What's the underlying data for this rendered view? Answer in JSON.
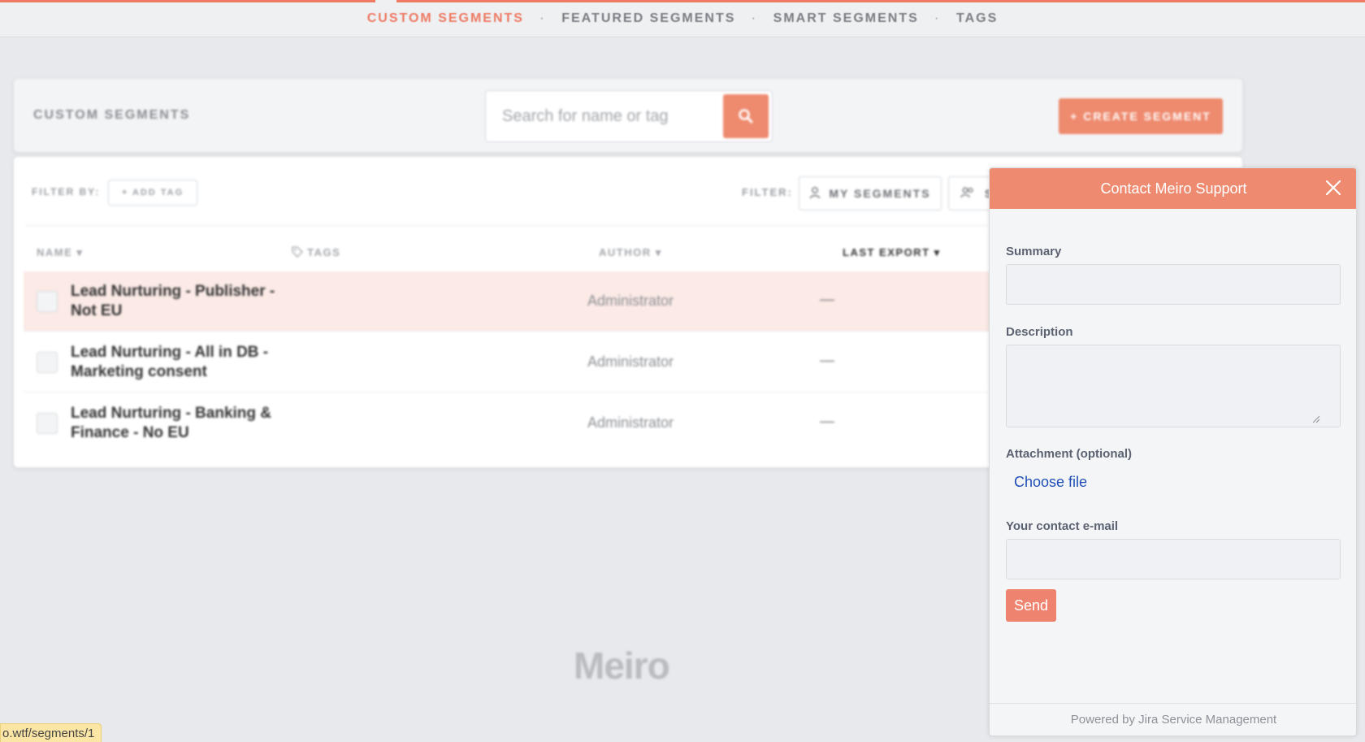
{
  "nav": {
    "items": [
      {
        "label": "CUSTOM SEGMENTS"
      },
      {
        "label": "FEATURED SEGMENTS"
      },
      {
        "label": "SMART SEGMENTS"
      },
      {
        "label": "TAGS"
      }
    ],
    "separator": "·"
  },
  "header": {
    "title": "CUSTOM SEGMENTS",
    "search_placeholder": "Search for name or tag",
    "search_icon": "search-icon",
    "create_label": "+ CREATE SEGMENT"
  },
  "filters": {
    "filter_by_label": "FILTER BY:",
    "add_tag_label": "+ ADD TAG",
    "filter_label": "FILTER:",
    "my_segments_label": "MY SEGMENTS",
    "shared_label": "S"
  },
  "table": {
    "columns": {
      "name": "NAME",
      "tags": "TAGS",
      "author": "AUTHOR",
      "last_export": "LAST EXPORT"
    },
    "rows": [
      {
        "name": "Lead Nurturing - Publisher - Not EU",
        "author": "Administrator",
        "last_export": "—"
      },
      {
        "name": "Lead Nurturing - All in DB - Marketing consent",
        "author": "Administrator",
        "last_export": "—"
      },
      {
        "name": "Lead Nurturing - Banking & Finance - No EU",
        "author": "Administrator",
        "last_export": "—"
      }
    ]
  },
  "footer": {
    "logo_text": "Meiro",
    "status_url": "o.wtf/segments/1"
  },
  "support_widget": {
    "title": "Contact Meiro Support",
    "summary_label": "Summary",
    "summary_value": "",
    "description_label": "Description",
    "description_value": "",
    "attachment_label": "Attachment (optional)",
    "choose_file_label": "Choose file",
    "email_label": "Your contact e-mail",
    "email_value": "",
    "send_label": "Send",
    "powered_by": "Powered by Jira Service Management"
  },
  "colors": {
    "accent": "#ee7a63",
    "widget_header": "#ee8a70",
    "link": "#1f4fb6"
  }
}
